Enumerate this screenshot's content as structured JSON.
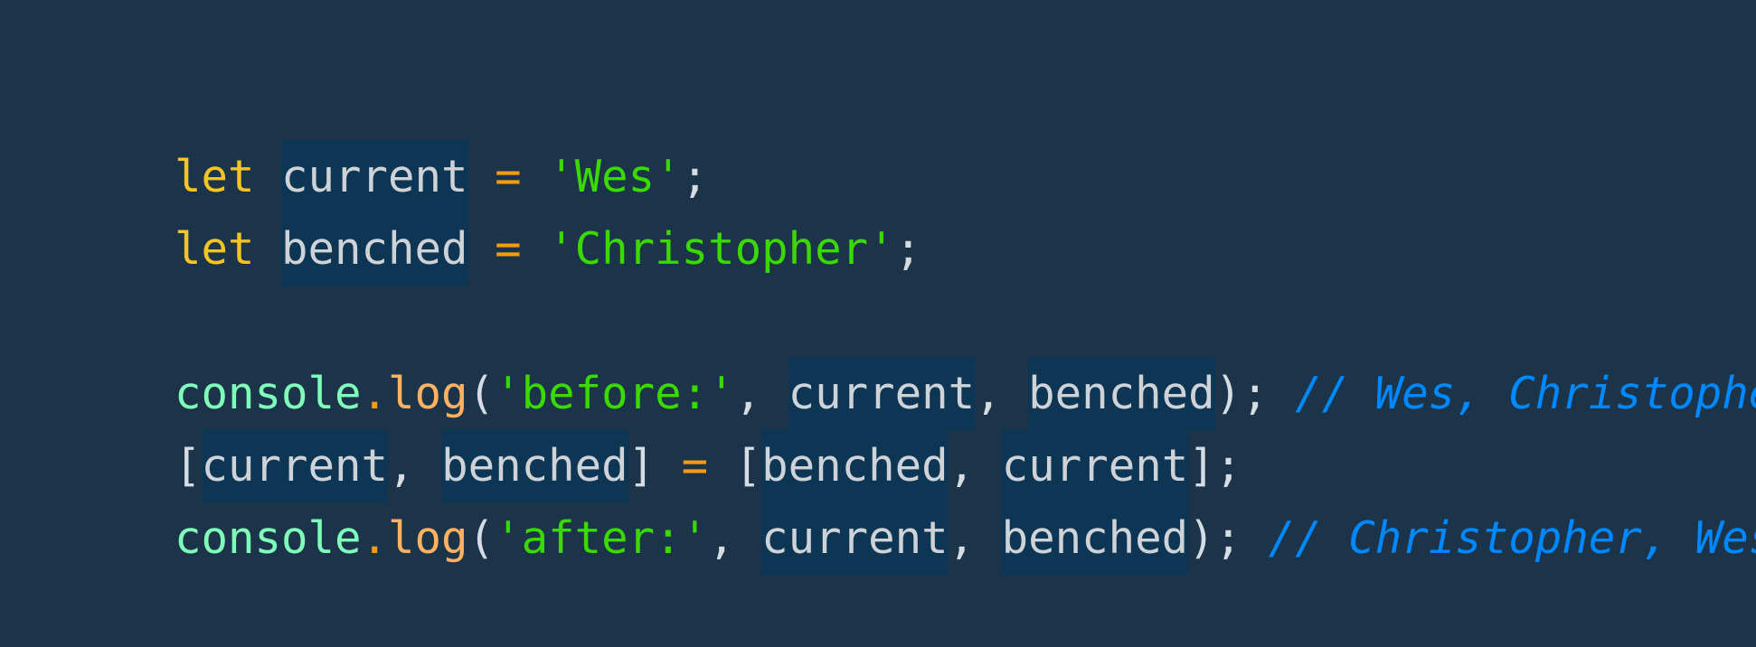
{
  "editor": {
    "lines": [
      [
        {
          "text": "let",
          "type": "kw"
        },
        {
          "text": " ",
          "type": "space"
        },
        {
          "text": "current",
          "type": "var"
        },
        {
          "text": " ",
          "type": "space"
        },
        {
          "text": "=",
          "type": "op"
        },
        {
          "text": " ",
          "type": "space"
        },
        {
          "text": "'Wes'",
          "type": "str"
        },
        {
          "text": ";",
          "type": "punc"
        }
      ],
      [
        {
          "text": "let",
          "type": "kw"
        },
        {
          "text": " ",
          "type": "space"
        },
        {
          "text": "benched",
          "type": "var"
        },
        {
          "text": " ",
          "type": "space"
        },
        {
          "text": "=",
          "type": "op"
        },
        {
          "text": " ",
          "type": "space"
        },
        {
          "text": "'Christopher'",
          "type": "str"
        },
        {
          "text": ";",
          "type": "punc"
        }
      ],
      [],
      [
        {
          "text": "console",
          "type": "obj"
        },
        {
          "text": ".",
          "type": "op"
        },
        {
          "text": "log",
          "type": "fn"
        },
        {
          "text": "(",
          "type": "punc"
        },
        {
          "text": "'before:'",
          "type": "str"
        },
        {
          "text": ", ",
          "type": "punc"
        },
        {
          "text": "current",
          "type": "var"
        },
        {
          "text": ", ",
          "type": "punc"
        },
        {
          "text": "benched",
          "type": "var"
        },
        {
          "text": ");",
          "type": "punc"
        },
        {
          "text": " ",
          "type": "space"
        },
        {
          "text": "// Wes, Christopher",
          "type": "cmt"
        }
      ],
      [
        {
          "text": "[",
          "type": "punc"
        },
        {
          "text": "current",
          "type": "var"
        },
        {
          "text": ", ",
          "type": "punc"
        },
        {
          "text": "benched",
          "type": "var"
        },
        {
          "text": "]",
          "type": "punc"
        },
        {
          "text": " ",
          "type": "space"
        },
        {
          "text": "=",
          "type": "op"
        },
        {
          "text": " ",
          "type": "space"
        },
        {
          "text": "[",
          "type": "punc"
        },
        {
          "text": "benched",
          "type": "var"
        },
        {
          "text": ", ",
          "type": "punc"
        },
        {
          "text": "current",
          "type": "var"
        },
        {
          "text": "];",
          "type": "punc"
        }
      ],
      [
        {
          "text": "console",
          "type": "obj"
        },
        {
          "text": ".",
          "type": "op"
        },
        {
          "text": "log",
          "type": "fn"
        },
        {
          "text": "(",
          "type": "punc"
        },
        {
          "text": "'after:'",
          "type": "str"
        },
        {
          "text": ", ",
          "type": "punc"
        },
        {
          "text": "current",
          "type": "var"
        },
        {
          "text": ", ",
          "type": "punc"
        },
        {
          "text": "benched",
          "type": "var"
        },
        {
          "text": ");",
          "type": "punc"
        },
        {
          "text": " ",
          "type": "space"
        },
        {
          "text": "// Christopher, Wes",
          "type": "cmt"
        }
      ]
    ]
  }
}
